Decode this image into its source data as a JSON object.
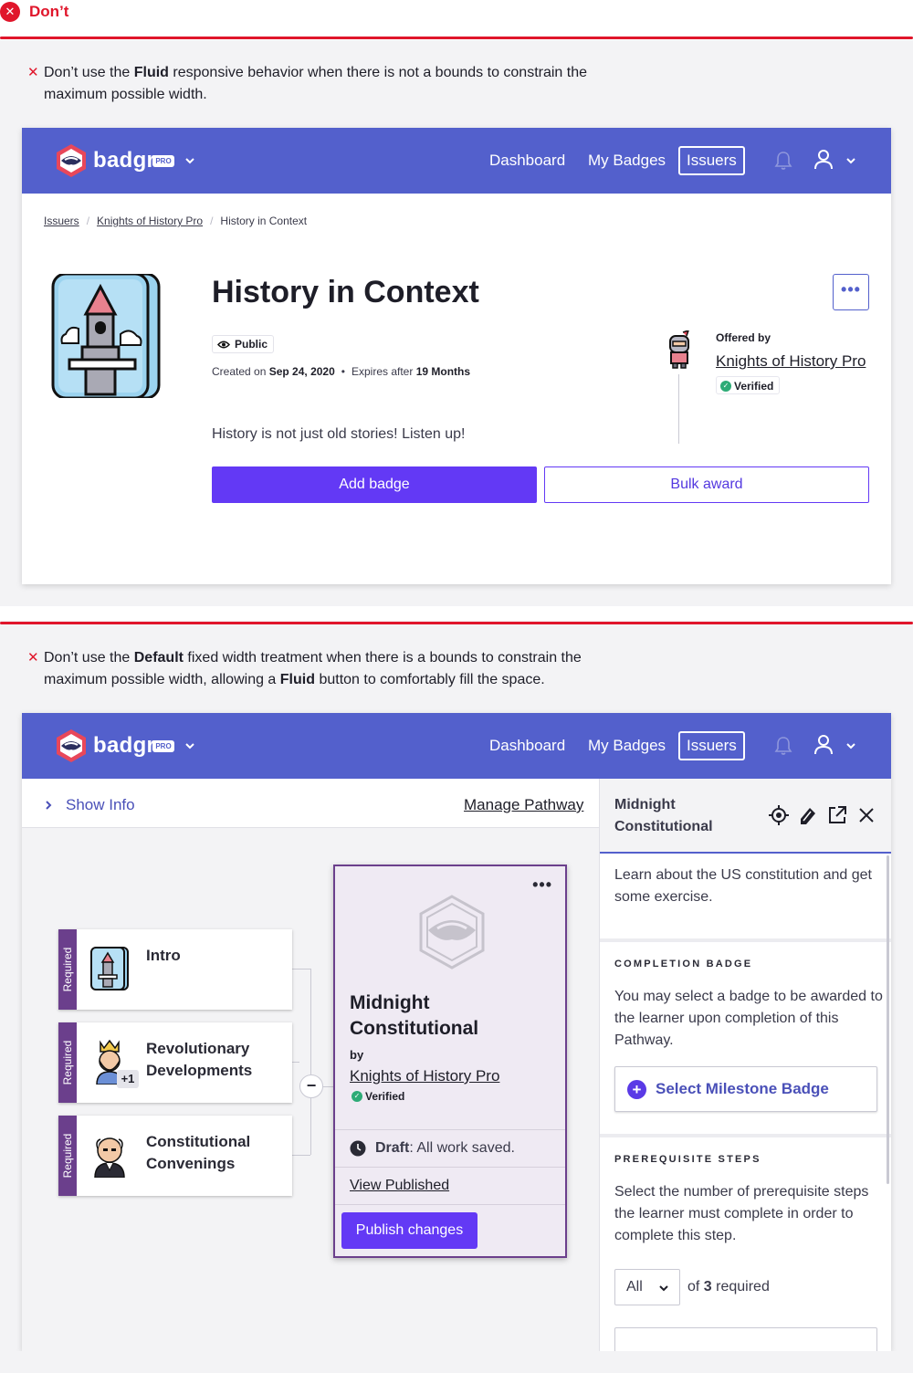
{
  "header": {
    "label": "Don’t"
  },
  "example1": {
    "note_prefix": "Don’t use the ",
    "note_bold": "Fluid",
    "note_rest": " responsive behavior when there is not a bounds to constrain the maximum possible width.",
    "nav": {
      "logo_text": "badgr",
      "pro": "PRO",
      "links": [
        "Dashboard",
        "My Badges",
        "Issuers"
      ]
    },
    "breadcrumb": [
      "Issuers",
      "Knights of History Pro",
      "History in Context"
    ],
    "badge_title": "History in Context",
    "visibility": "Public",
    "created_label": "Created on ",
    "created_date": "Sep 24, 2020",
    "expires_label": "Expires after ",
    "expires_value": "19 Months",
    "description": "History is not just old stories! Listen up!",
    "offered_by_label": "Offered by",
    "issuer": "Knights of History Pro",
    "verified": "Verified",
    "primary_button": "Add badge",
    "secondary_button": "Bulk award",
    "more": "•••"
  },
  "example2": {
    "note_prefix": "Don’t use the ",
    "note_bold1": "Default",
    "note_mid": " fixed width treatment when there is a bounds to constrain the maximum possible width, allowing a ",
    "note_bold2": "Fluid",
    "note_rest": " button to comfortably fill the space.",
    "show_info": "Show Info",
    "manage_pathway": "Manage Pathway",
    "steps": [
      {
        "tag": "Required",
        "label": "Intro"
      },
      {
        "tag": "Required",
        "label": "Revolutionary Developments",
        "extra": "+1"
      },
      {
        "tag": "Required",
        "label": "Constitutional Convenings"
      }
    ],
    "milestone": {
      "title": "Midnight Constitutional",
      "by": "by",
      "issuer": "Knights of History Pro",
      "verified": "Verified",
      "draft_bold": "Draft",
      "draft_rest": ": All work saved.",
      "view_published": "View Published",
      "publish": "Publish changes",
      "more": "•••"
    },
    "panel": {
      "title": "Midnight Constitutional",
      "description": "Learn about the US constitution and get some exercise.",
      "completion_caption": "COMPLETION BADGE",
      "completion_text": "You may select a badge to be awarded to the learner upon completion of this Pathway.",
      "select_button": "Select Milestone Badge",
      "prereq_caption": "PREREQUISITE STEPS",
      "prereq_text": "Select the number of prerequisite steps the learner must complete in order to complete this step.",
      "dropdown_value": "All",
      "of_label": "of ",
      "required_count": "3",
      "required_label": " required"
    }
  },
  "colors": {
    "danger": "#e0162b",
    "nav": "#5360cc",
    "primary": "#6339f5",
    "required": "#6b3f8c",
    "verified": "#2dab76"
  }
}
